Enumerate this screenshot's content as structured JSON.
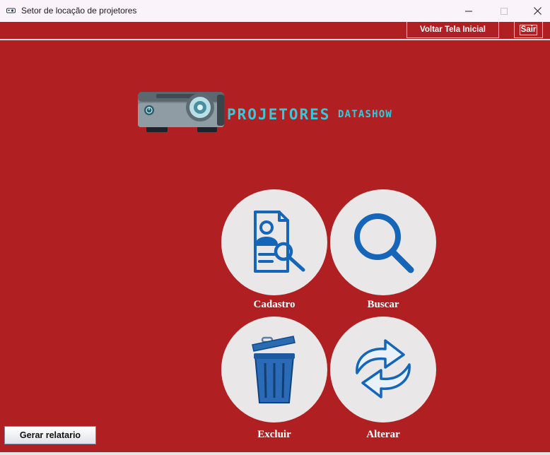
{
  "window": {
    "title": "Setor de locação de projetores",
    "minimize_glyph": "—",
    "maximize_glyph": "☐",
    "close_glyph": "✕"
  },
  "toolbar": {
    "back_label": "Voltar Tela Inicial",
    "exit_label": "Sair"
  },
  "logo": {
    "word1": "PROJETORES",
    "word2": "DATASHOW",
    "color": "#37c8d8"
  },
  "actions": {
    "cadastro_label": "Cadastro",
    "buscar_label": "Buscar",
    "excluir_label": "Excluir",
    "alterar_label": "Alterar",
    "icon_color": "#1565b8",
    "circle_color": "#e9e7e7"
  },
  "footer": {
    "report_label": "Gerar relatario"
  },
  "theme": {
    "background": "#b02022"
  }
}
